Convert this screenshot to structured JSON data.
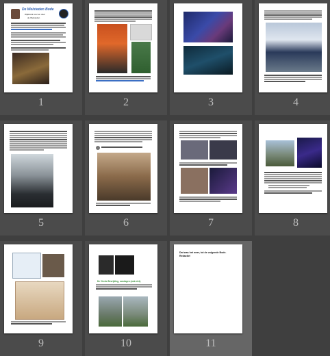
{
  "thumbnails": [
    {
      "number": "1"
    },
    {
      "number": "2"
    },
    {
      "number": "3"
    },
    {
      "number": "4"
    },
    {
      "number": "5"
    },
    {
      "number": "6"
    },
    {
      "number": "7"
    },
    {
      "number": "8"
    },
    {
      "number": "9"
    },
    {
      "number": "10"
    },
    {
      "number": "11"
    }
  ],
  "page1": {
    "masthead": "De Welsteden Bode",
    "subtitle": "Wijkkrant voor en door",
    "subtitle2": "de Welsteden"
  },
  "page10": {
    "heading": "De Vierde Bevrijding, zondagen (ook niet)."
  },
  "page11": {
    "line1": "Dat was het weer, tot de volgende Bode.",
    "line2": "Redactie!"
  },
  "colors": {
    "background": "#3f3f3f",
    "selected": "#666666",
    "accent_green": "#3a8f3a",
    "accent_blue": "#2a5db0"
  }
}
